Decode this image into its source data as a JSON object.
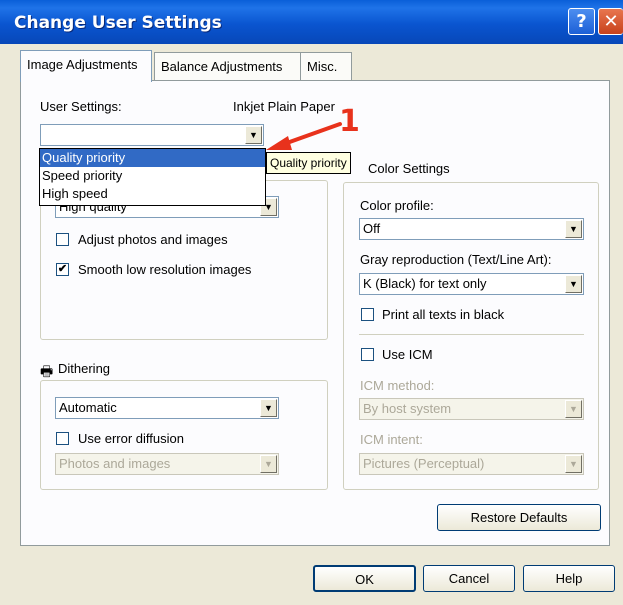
{
  "window": {
    "title": "Change User Settings",
    "help_glyph": "?",
    "close_glyph": "✕"
  },
  "tabs": [
    {
      "label": "Image Adjustments",
      "active": true
    },
    {
      "label": "Balance Adjustments",
      "active": false
    },
    {
      "label": "Misc.",
      "active": false
    }
  ],
  "user_settings": {
    "label": "User Settings:",
    "paper": "Inkjet Plain Paper",
    "value": ""
  },
  "dropdown_options": [
    "Quality priority",
    "Speed priority",
    "High speed"
  ],
  "dropdown_selected": "Quality priority",
  "tooltip": "Quality priority",
  "annotation_number": "1",
  "quality": {
    "select_value": "High quality",
    "adjust_photos": {
      "label": "Adjust photos and images",
      "checked": false
    },
    "smooth_images": {
      "label": "Smooth low resolution images",
      "checked": true
    }
  },
  "dithering": {
    "title": "Dithering",
    "select_value": "Automatic",
    "error_diffusion": {
      "label": "Use error diffusion",
      "checked": false
    },
    "secondary_value": "Photos and images"
  },
  "color_settings": {
    "title": "Color Settings",
    "profile_label": "Color profile:",
    "profile_value": "Off",
    "gray_label": "Gray reproduction (Text/Line Art):",
    "gray_value": "K (Black) for text only",
    "print_black": {
      "label": "Print all texts in black",
      "checked": false
    },
    "use_icm": {
      "label": "Use ICM",
      "checked": false
    },
    "icm_method_label": "ICM method:",
    "icm_method_value": "By host system",
    "icm_intent_label": "ICM intent:",
    "icm_intent_value": "Pictures (Perceptual)"
  },
  "buttons": {
    "restore": "Restore Defaults",
    "ok": "OK",
    "cancel": "Cancel",
    "help": "Help"
  },
  "colors": {
    "title_bar": "#0a55d0",
    "selection": "#316ac5",
    "annotation": "#e8321c",
    "tooltip_bg": "#ffffe1"
  }
}
